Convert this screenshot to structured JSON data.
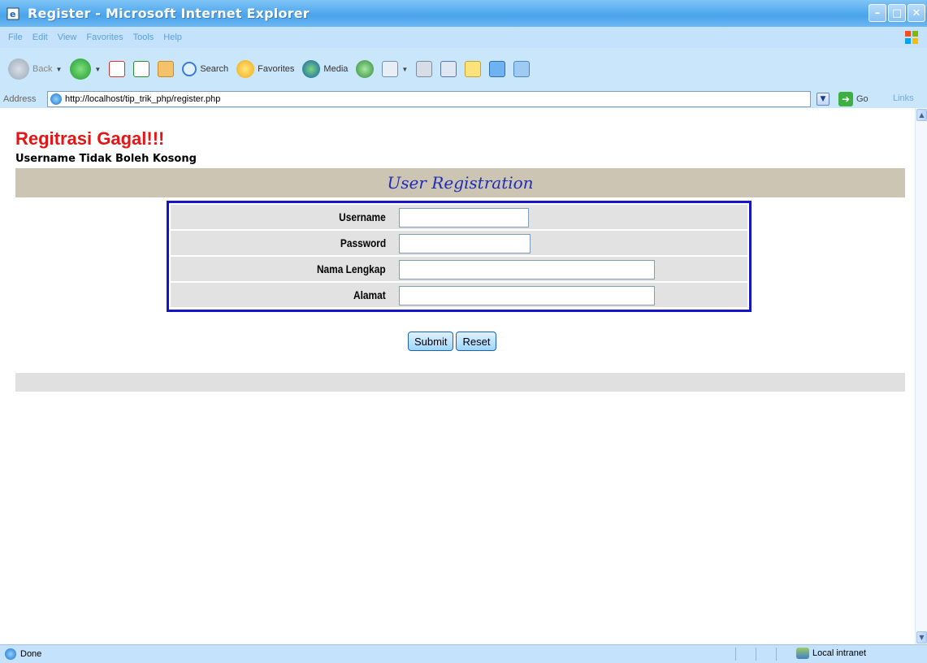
{
  "window": {
    "title": "Register - Microsoft Internet Explorer"
  },
  "menu": [
    "File",
    "Edit",
    "View",
    "Favorites",
    "Tools",
    "Help"
  ],
  "toolbar": {
    "back_label": "Back",
    "search_label": "Search",
    "favorites_label": "Favorites",
    "media_label": "Media"
  },
  "address": {
    "label": "Address",
    "url": "http://localhost/tip_trik_php/register.php",
    "go_label": "Go",
    "links_label": "Links"
  },
  "page": {
    "error_title": "Regitrasi Gagal!!!",
    "error_message": "Username Tidak Boleh Kosong",
    "header": "User Registration",
    "fields": [
      {
        "label": "Username",
        "value": ""
      },
      {
        "label": "Password",
        "value": ""
      },
      {
        "label": "Nama Lengkap",
        "value": ""
      },
      {
        "label": "Alamat",
        "value": ""
      }
    ],
    "submit_label": "Submit",
    "reset_label": "Reset"
  },
  "status": {
    "text": "Done",
    "zone": "Local intranet"
  },
  "colors": {
    "error": "#e41515",
    "header_bg": "#ccc5b4",
    "header_text": "#1f2db5",
    "form_border": "#1414c8"
  }
}
